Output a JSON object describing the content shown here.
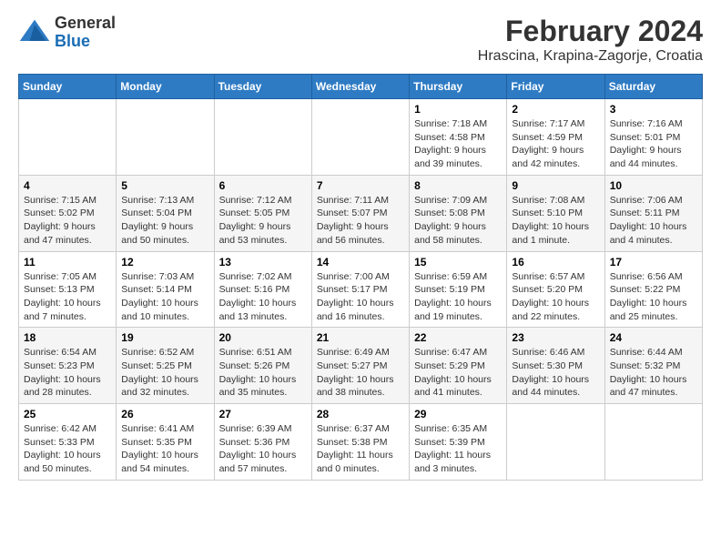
{
  "header": {
    "logo_general": "General",
    "logo_blue": "Blue",
    "month_title": "February 2024",
    "location": "Hrascina, Krapina-Zagorje, Croatia"
  },
  "weekdays": [
    "Sunday",
    "Monday",
    "Tuesday",
    "Wednesday",
    "Thursday",
    "Friday",
    "Saturday"
  ],
  "weeks": [
    [
      {
        "day": "",
        "info": ""
      },
      {
        "day": "",
        "info": ""
      },
      {
        "day": "",
        "info": ""
      },
      {
        "day": "",
        "info": ""
      },
      {
        "day": "1",
        "info": "Sunrise: 7:18 AM\nSunset: 4:58 PM\nDaylight: 9 hours\nand 39 minutes."
      },
      {
        "day": "2",
        "info": "Sunrise: 7:17 AM\nSunset: 4:59 PM\nDaylight: 9 hours\nand 42 minutes."
      },
      {
        "day": "3",
        "info": "Sunrise: 7:16 AM\nSunset: 5:01 PM\nDaylight: 9 hours\nand 44 minutes."
      }
    ],
    [
      {
        "day": "4",
        "info": "Sunrise: 7:15 AM\nSunset: 5:02 PM\nDaylight: 9 hours\nand 47 minutes."
      },
      {
        "day": "5",
        "info": "Sunrise: 7:13 AM\nSunset: 5:04 PM\nDaylight: 9 hours\nand 50 minutes."
      },
      {
        "day": "6",
        "info": "Sunrise: 7:12 AM\nSunset: 5:05 PM\nDaylight: 9 hours\nand 53 minutes."
      },
      {
        "day": "7",
        "info": "Sunrise: 7:11 AM\nSunset: 5:07 PM\nDaylight: 9 hours\nand 56 minutes."
      },
      {
        "day": "8",
        "info": "Sunrise: 7:09 AM\nSunset: 5:08 PM\nDaylight: 9 hours\nand 58 minutes."
      },
      {
        "day": "9",
        "info": "Sunrise: 7:08 AM\nSunset: 5:10 PM\nDaylight: 10 hours\nand 1 minute."
      },
      {
        "day": "10",
        "info": "Sunrise: 7:06 AM\nSunset: 5:11 PM\nDaylight: 10 hours\nand 4 minutes."
      }
    ],
    [
      {
        "day": "11",
        "info": "Sunrise: 7:05 AM\nSunset: 5:13 PM\nDaylight: 10 hours\nand 7 minutes."
      },
      {
        "day": "12",
        "info": "Sunrise: 7:03 AM\nSunset: 5:14 PM\nDaylight: 10 hours\nand 10 minutes."
      },
      {
        "day": "13",
        "info": "Sunrise: 7:02 AM\nSunset: 5:16 PM\nDaylight: 10 hours\nand 13 minutes."
      },
      {
        "day": "14",
        "info": "Sunrise: 7:00 AM\nSunset: 5:17 PM\nDaylight: 10 hours\nand 16 minutes."
      },
      {
        "day": "15",
        "info": "Sunrise: 6:59 AM\nSunset: 5:19 PM\nDaylight: 10 hours\nand 19 minutes."
      },
      {
        "day": "16",
        "info": "Sunrise: 6:57 AM\nSunset: 5:20 PM\nDaylight: 10 hours\nand 22 minutes."
      },
      {
        "day": "17",
        "info": "Sunrise: 6:56 AM\nSunset: 5:22 PM\nDaylight: 10 hours\nand 25 minutes."
      }
    ],
    [
      {
        "day": "18",
        "info": "Sunrise: 6:54 AM\nSunset: 5:23 PM\nDaylight: 10 hours\nand 28 minutes."
      },
      {
        "day": "19",
        "info": "Sunrise: 6:52 AM\nSunset: 5:25 PM\nDaylight: 10 hours\nand 32 minutes."
      },
      {
        "day": "20",
        "info": "Sunrise: 6:51 AM\nSunset: 5:26 PM\nDaylight: 10 hours\nand 35 minutes."
      },
      {
        "day": "21",
        "info": "Sunrise: 6:49 AM\nSunset: 5:27 PM\nDaylight: 10 hours\nand 38 minutes."
      },
      {
        "day": "22",
        "info": "Sunrise: 6:47 AM\nSunset: 5:29 PM\nDaylight: 10 hours\nand 41 minutes."
      },
      {
        "day": "23",
        "info": "Sunrise: 6:46 AM\nSunset: 5:30 PM\nDaylight: 10 hours\nand 44 minutes."
      },
      {
        "day": "24",
        "info": "Sunrise: 6:44 AM\nSunset: 5:32 PM\nDaylight: 10 hours\nand 47 minutes."
      }
    ],
    [
      {
        "day": "25",
        "info": "Sunrise: 6:42 AM\nSunset: 5:33 PM\nDaylight: 10 hours\nand 50 minutes."
      },
      {
        "day": "26",
        "info": "Sunrise: 6:41 AM\nSunset: 5:35 PM\nDaylight: 10 hours\nand 54 minutes."
      },
      {
        "day": "27",
        "info": "Sunrise: 6:39 AM\nSunset: 5:36 PM\nDaylight: 10 hours\nand 57 minutes."
      },
      {
        "day": "28",
        "info": "Sunrise: 6:37 AM\nSunset: 5:38 PM\nDaylight: 11 hours\nand 0 minutes."
      },
      {
        "day": "29",
        "info": "Sunrise: 6:35 AM\nSunset: 5:39 PM\nDaylight: 11 hours\nand 3 minutes."
      },
      {
        "day": "",
        "info": ""
      },
      {
        "day": "",
        "info": ""
      }
    ]
  ]
}
